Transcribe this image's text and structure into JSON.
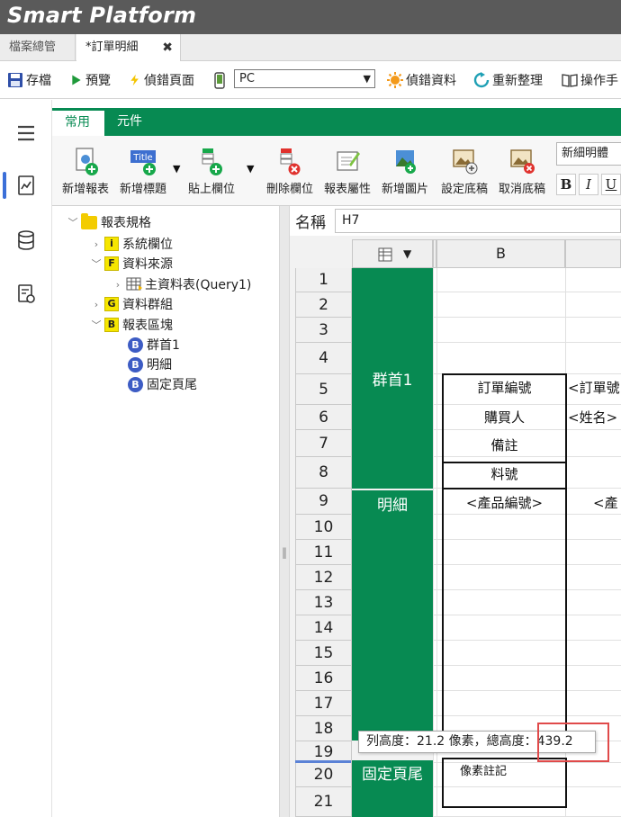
{
  "app": {
    "title": "Smart Platform"
  },
  "file_tabs": [
    {
      "label": "檔案總管",
      "active": false
    },
    {
      "label": "*訂單明細",
      "active": true
    }
  ],
  "toolbar": {
    "save": "存檔",
    "preview": "預覽",
    "debug_page": "偵錯頁面",
    "device_select": "PC",
    "debug_data": "偵錯資料",
    "refresh": "重新整理",
    "manual": "操作手"
  },
  "ribbon": {
    "tabs": [
      "常用",
      "元件"
    ],
    "buttons": {
      "new_report": "新增報表",
      "new_title": "新增標題",
      "title_badge": "Title",
      "paste_field": "貼上欄位",
      "delete_field": "刪除欄位",
      "report_props": "報表屬性",
      "new_image": "新增圖片",
      "set_background": "設定底稿",
      "cancel_background": "取消底稿"
    },
    "font_name": "新細明體",
    "format_buttons": [
      "B",
      "I",
      "U"
    ]
  },
  "tree": {
    "root": "報表規格",
    "items": [
      {
        "label": "系統欄位",
        "badge": "i"
      },
      {
        "label": "資料來源",
        "badge": "F"
      },
      {
        "label": "主資料表(Query1)",
        "badge": ""
      },
      {
        "label": "資料群組",
        "badge": "G"
      },
      {
        "label": "報表區塊",
        "badge": "B"
      },
      {
        "label": "群首1",
        "badge": "B"
      },
      {
        "label": "明細",
        "badge": "B"
      },
      {
        "label": "固定頁尾",
        "badge": "B"
      }
    ]
  },
  "sheet": {
    "name_label": "名稱",
    "name_value": "H7",
    "column_header": "B",
    "row_numbers": [
      "1",
      "2",
      "3",
      "4",
      "5",
      "6",
      "7",
      "8",
      "9",
      "10",
      "11",
      "12",
      "13",
      "14",
      "15",
      "16",
      "17",
      "18",
      "19",
      "20",
      "21"
    ],
    "bands": {
      "group_header": "群首1",
      "detail": "明細",
      "footer": "固定頁尾"
    },
    "cells": {
      "order_no_label": "訂單編號",
      "order_no_value": "<訂單號",
      "buyer_label": "購買人",
      "buyer_value": "<姓名>",
      "note_label": "備註",
      "part_no_label": "料號",
      "part_no_value": "<產品編號>",
      "part_name_value": "<產",
      "footer_text": "像素註記"
    },
    "tooltip": "列高度：21.2 像素，總高度：439.2"
  },
  "colors": {
    "accent_green": "#078a52",
    "title_bar": "#5a5a5a",
    "highlight_red": "#e04a4a"
  }
}
